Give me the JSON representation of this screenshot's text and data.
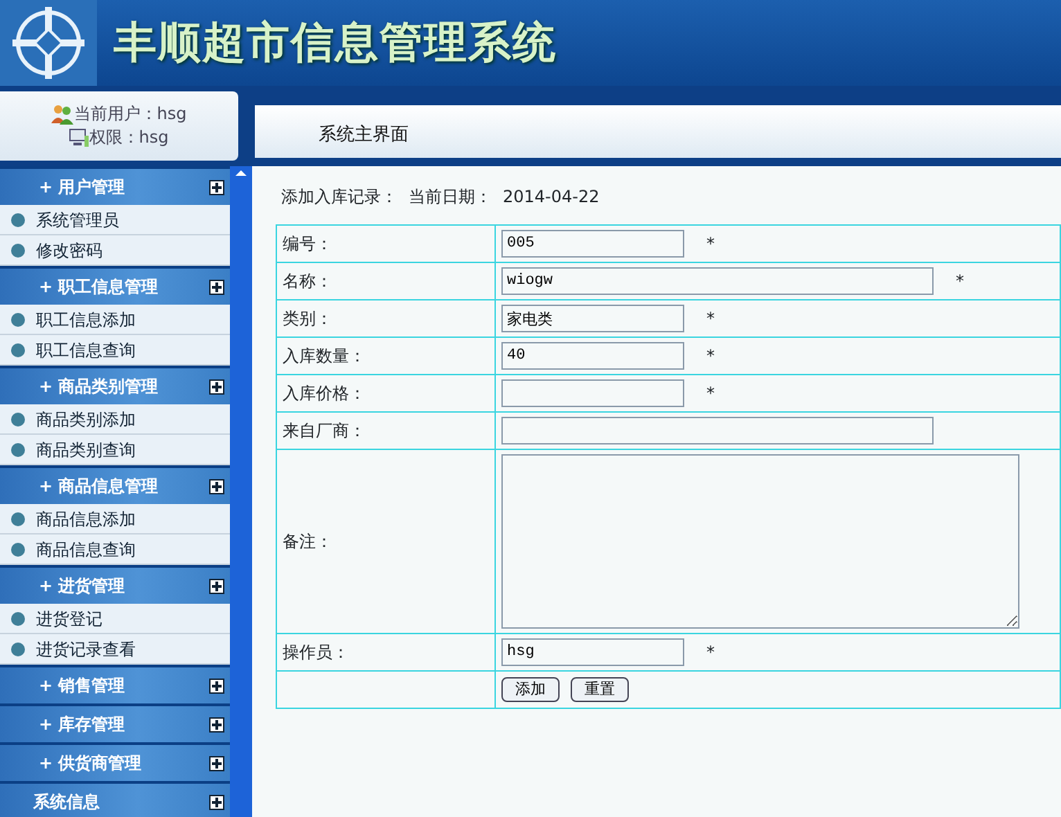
{
  "header": {
    "title": "丰顺超市信息管理系统"
  },
  "user_panel": {
    "user_label": "当前用户：hsg",
    "role_label": "权限：hsg"
  },
  "page_title": "系统主界面",
  "sidebar": {
    "groups": [
      {
        "marker": "+",
        "label": "用户管理",
        "children": [
          {
            "label": "系统管理员"
          },
          {
            "label": "修改密码"
          }
        ]
      },
      {
        "marker": "+",
        "label": "职工信息管理",
        "children": [
          {
            "label": "职工信息添加"
          },
          {
            "label": "职工信息查询"
          }
        ]
      },
      {
        "marker": "+",
        "label": "商品类别管理",
        "children": [
          {
            "label": "商品类别添加"
          },
          {
            "label": "商品类别查询"
          }
        ]
      },
      {
        "marker": "+",
        "label": "商品信息管理",
        "children": [
          {
            "label": "商品信息添加"
          },
          {
            "label": "商品信息查询"
          }
        ]
      },
      {
        "marker": "+",
        "label": "进货管理",
        "children": [
          {
            "label": "进货登记"
          },
          {
            "label": "进货记录查看"
          }
        ]
      },
      {
        "marker": "+",
        "label": "销售管理"
      },
      {
        "marker": "+",
        "label": "库存管理"
      },
      {
        "marker": "+",
        "label": "供货商管理"
      },
      {
        "label": "系统信息"
      }
    ]
  },
  "form": {
    "heading": "添加入库记录：",
    "date_label": "当前日期：",
    "date": "2014-04-22",
    "rows": [
      {
        "kind": "short",
        "label": "编号：",
        "value": "005",
        "required": "*"
      },
      {
        "kind": "long",
        "label": "名称：",
        "value": "wiogw",
        "required": "*"
      },
      {
        "kind": "short",
        "label": "类别：",
        "value": "家电类",
        "required": "*"
      },
      {
        "kind": "short",
        "label": "入库数量：",
        "value": "40",
        "required": "*"
      },
      {
        "kind": "short",
        "label": "入库价格：",
        "required": "*"
      },
      {
        "kind": "long",
        "label": "来自厂商："
      },
      {
        "kind": "area",
        "label": "备注："
      },
      {
        "kind": "short",
        "label": "操作员：",
        "value": "hsg",
        "required": "*"
      }
    ],
    "buttons": [
      "添加",
      "重置"
    ]
  }
}
